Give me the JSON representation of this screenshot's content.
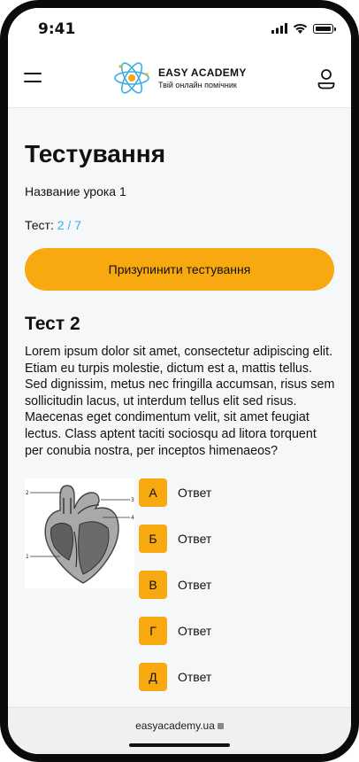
{
  "status_bar": {
    "time": "9:41"
  },
  "header": {
    "brand_title": "EASY ACADEMY",
    "brand_subtitle": "Твій онлайн помічник",
    "colors": {
      "accent_orange": "#f8a910",
      "accent_blue": "#3aaee8"
    }
  },
  "page": {
    "title": "Тестування",
    "lesson_name": "Название урока 1",
    "progress_label": "Тест:",
    "progress_value": "2 / 7",
    "pause_button": "Призупинити тестування"
  },
  "test": {
    "title": "Тест 2",
    "question": "Lorem ipsum dolor sit amet, consectetur adipiscing elit. Etiam eu turpis molestie, dictum est a, mattis tellus. Sed dignissim, metus nec fringilla accumsan, risus sem sollicitudin lacus, ut interdum tellus elit sed risus. Maecenas eget condimentum velit, sit amet feugiat lectus. Class aptent taciti sociosqu ad litora torquent per conubia nostra, per inceptos himenaeos?",
    "figure_labels": [
      "1",
      "2",
      "3",
      "4"
    ],
    "answers": [
      {
        "letter": "А",
        "text": "Ответ"
      },
      {
        "letter": "Б",
        "text": "Ответ"
      },
      {
        "letter": "В",
        "text": "Ответ"
      },
      {
        "letter": "Г",
        "text": "Ответ"
      },
      {
        "letter": "Д",
        "text": "Ответ"
      }
    ]
  },
  "browser": {
    "url": "easyacademy.ua"
  }
}
